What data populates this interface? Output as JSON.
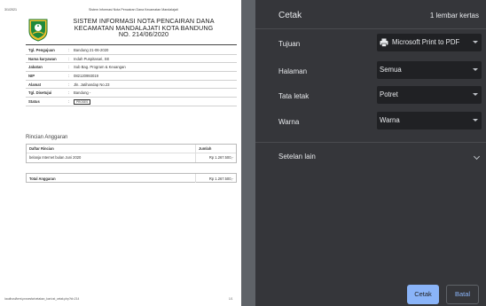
{
  "document": {
    "print_date": "3/1/2021",
    "page_header_title": "Sistem Informasi Nota Pencairan Dana Kecamatan Mandalajati",
    "title_lines": [
      "SISTEM INFORMASI NOTA PENCAIRAN DANA",
      "KECAMATAN MANDALAJATI KOTA BANDUNG",
      "NO. 214/06/2020"
    ],
    "fields": [
      {
        "label": "Tgl. Pengajuan",
        "sep": ":",
        "value": "Bandung 21-06-2020"
      },
      {
        "label": "Nama karyawan",
        "sep": ":",
        "value": "Indah Puspitasari, SE"
      },
      {
        "label": "Jabatan",
        "sep": ":",
        "value": "Sub Bag. Program & Keuangan"
      },
      {
        "label": "NIP",
        "sep": ":",
        "value": "082120993019"
      },
      {
        "label": "Alamat",
        "sep": ":",
        "value": "Jln. Jatihandap No.23"
      },
      {
        "label": "Tgl. Disetujui",
        "sep": ":",
        "value": "Bandung -"
      },
      {
        "label": "Status",
        "sep": ":",
        "value": "PROSES"
      }
    ],
    "rincian_title": "Rincian Anggaran",
    "rincian_table": {
      "headers": [
        "Daftar Rincian",
        "Jumlah"
      ],
      "rows": [
        [
          "belanja Internet bulan Juni 2020",
          "Rp 1.267.500,-"
        ]
      ]
    },
    "total": {
      "label": "Total Anggaran",
      "value": "Rp 1.267.500,-"
    },
    "footer_url": "localhost/kent-prosesfw/cetakan_kon/cst_cetak.php?id=214",
    "footer_page": "1/1"
  },
  "print_panel": {
    "title": "Cetak",
    "sheets": "1 lembar kertas",
    "destination": {
      "label": "Tujuan",
      "value": "Microsoft Print to PDF",
      "icon": "printer-icon"
    },
    "pages": {
      "label": "Halaman",
      "value": "Semua"
    },
    "layout": {
      "label": "Tata letak",
      "value": "Potret"
    },
    "color": {
      "label": "Warna",
      "value": "Warna"
    },
    "more_settings": "Setelan lain",
    "print_button": "Cetak",
    "cancel_button": "Batal"
  }
}
